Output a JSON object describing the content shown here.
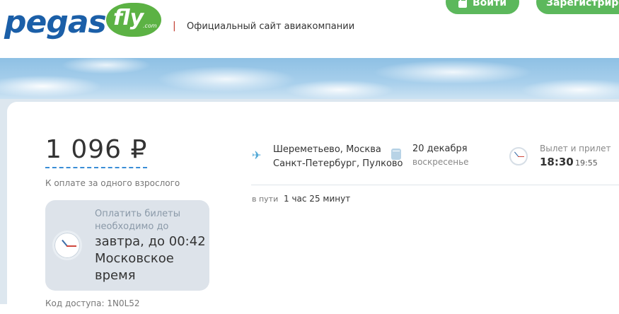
{
  "header": {
    "logo_word": "pegas",
    "logo_fly": "fly",
    "logo_com": ".com",
    "separator": "|",
    "tagline": "Официальный сайт авиакомпании",
    "login_label": "Войти",
    "register_label": "Зарегистрироваться"
  },
  "fare": {
    "price": "1 096 ₽",
    "caption": "К оплате за одного взрослого"
  },
  "deadline": {
    "label": "Оплатить билеты необходимо до",
    "time": "завтра, до 00:42 Московское время"
  },
  "access_code": "Код доступа: 1N0L52",
  "flight": {
    "from": "Шереметьево, Москва",
    "to": "Санкт-Петербург, Пулково",
    "date": "20 декабря",
    "weekday": "воскресенье",
    "times_label": "Вылет и прилет",
    "departure": "18:30",
    "arrival": "19:55",
    "duration_label": "в пути",
    "duration": "1 час 25 минут"
  },
  "colors": {
    "brand_blue": "#1b5fa8",
    "brand_green": "#5cb244",
    "button_green": "#5cb85c",
    "accent_dashed": "#3a8dd6"
  },
  "icons": {
    "plane": "plane-icon",
    "calendar": "calendar-icon",
    "clock": "clock-icon",
    "lock": "lock-icon"
  }
}
